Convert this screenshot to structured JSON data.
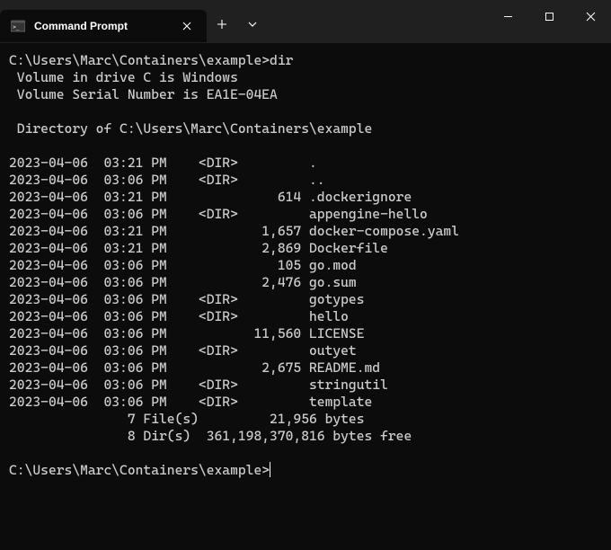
{
  "window": {
    "tab": {
      "title": "Command Prompt"
    }
  },
  "terminal": {
    "prompt1": "C:\\Users\\Marc\\Containers\\example>",
    "command1": "dir",
    "volume_line": " Volume in drive C is Windows",
    "serial_line": " Volume Serial Number is EA1E-04EA",
    "dirof_line": " Directory of C:\\Users\\Marc\\Containers\\example",
    "entries": [
      {
        "date": "2023-04-06",
        "time": "03:21 PM",
        "attr": "<DIR>",
        "size": "",
        "name": "."
      },
      {
        "date": "2023-04-06",
        "time": "03:06 PM",
        "attr": "<DIR>",
        "size": "",
        "name": ".."
      },
      {
        "date": "2023-04-06",
        "time": "03:21 PM",
        "attr": "",
        "size": "614",
        "name": ".dockerignore"
      },
      {
        "date": "2023-04-06",
        "time": "03:06 PM",
        "attr": "<DIR>",
        "size": "",
        "name": "appengine-hello"
      },
      {
        "date": "2023-04-06",
        "time": "03:21 PM",
        "attr": "",
        "size": "1,657",
        "name": "docker-compose.yaml"
      },
      {
        "date": "2023-04-06",
        "time": "03:21 PM",
        "attr": "",
        "size": "2,869",
        "name": "Dockerfile"
      },
      {
        "date": "2023-04-06",
        "time": "03:06 PM",
        "attr": "",
        "size": "105",
        "name": "go.mod"
      },
      {
        "date": "2023-04-06",
        "time": "03:06 PM",
        "attr": "",
        "size": "2,476",
        "name": "go.sum"
      },
      {
        "date": "2023-04-06",
        "time": "03:06 PM",
        "attr": "<DIR>",
        "size": "",
        "name": "gotypes"
      },
      {
        "date": "2023-04-06",
        "time": "03:06 PM",
        "attr": "<DIR>",
        "size": "",
        "name": "hello"
      },
      {
        "date": "2023-04-06",
        "time": "03:06 PM",
        "attr": "",
        "size": "11,560",
        "name": "LICENSE"
      },
      {
        "date": "2023-04-06",
        "time": "03:06 PM",
        "attr": "<DIR>",
        "size": "",
        "name": "outyet"
      },
      {
        "date": "2023-04-06",
        "time": "03:06 PM",
        "attr": "",
        "size": "2,675",
        "name": "README.md"
      },
      {
        "date": "2023-04-06",
        "time": "03:06 PM",
        "attr": "<DIR>",
        "size": "",
        "name": "stringutil"
      },
      {
        "date": "2023-04-06",
        "time": "03:06 PM",
        "attr": "<DIR>",
        "size": "",
        "name": "template"
      }
    ],
    "summary_files": "               7 File(s)         21,956 bytes",
    "summary_dirs": "               8 Dir(s)  361,198,370,816 bytes free",
    "prompt2": "C:\\Users\\Marc\\Containers\\example>"
  }
}
